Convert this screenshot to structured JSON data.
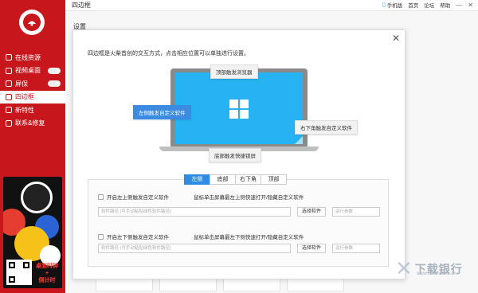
{
  "titlebar": {
    "title": "四边框",
    "phone": "手机版",
    "home": "首页",
    "forum": "论坛",
    "help": "帮助",
    "min": "—",
    "close": "✕"
  },
  "sidebar": {
    "items": [
      {
        "label": "在线资源"
      },
      {
        "label": "视频桌面"
      },
      {
        "label": "屏保"
      },
      {
        "label": "四边框"
      },
      {
        "label": "新特性"
      },
      {
        "label": "联系&修复"
      }
    ],
    "promo_text_1": "桌面时钟",
    "promo_text_2": "+",
    "promo_text_3": "倒计时"
  },
  "main": {
    "settings_label": "设置"
  },
  "dialog": {
    "close": "✕",
    "intro": "四边框是火柴首创的交互方式，点击相应位置可以单独进行设置。",
    "callouts": {
      "top": "顶部触发浏览器",
      "left": "左侧触发自定义软件",
      "right": "右下角触发自定义软件",
      "bottom": "底部触发快捷锁屏"
    },
    "tabs": [
      "左侧",
      "底部",
      "右下角",
      "顶部"
    ],
    "rows": [
      {
        "checkbox_label": "开启左上侧触发自定义软件",
        "hint": "鼠标单击屏幕最左上侧快速打开/隐藏自定义软件",
        "path_placeholder": "软件路径 (可手动粘贴绿色软件路径)",
        "select_label": "选择软件",
        "param_placeholder": "运行参数"
      },
      {
        "checkbox_label": "开启左下侧触发自定义软件",
        "hint": "鼠标单击屏幕最左下侧快速打开/隐藏自定义软件",
        "path_placeholder": "软件路径 (可手动粘贴绿色软件路径)",
        "select_label": "选择软件",
        "param_placeholder": "运行参数"
      }
    ]
  },
  "watermark": {
    "brand": "下载银行",
    "site": "www.downbank.cn"
  },
  "colors": {
    "brand_red": "#c8161d",
    "screen_blue": "#27b3f3",
    "tab_active": "#2e8de2"
  }
}
